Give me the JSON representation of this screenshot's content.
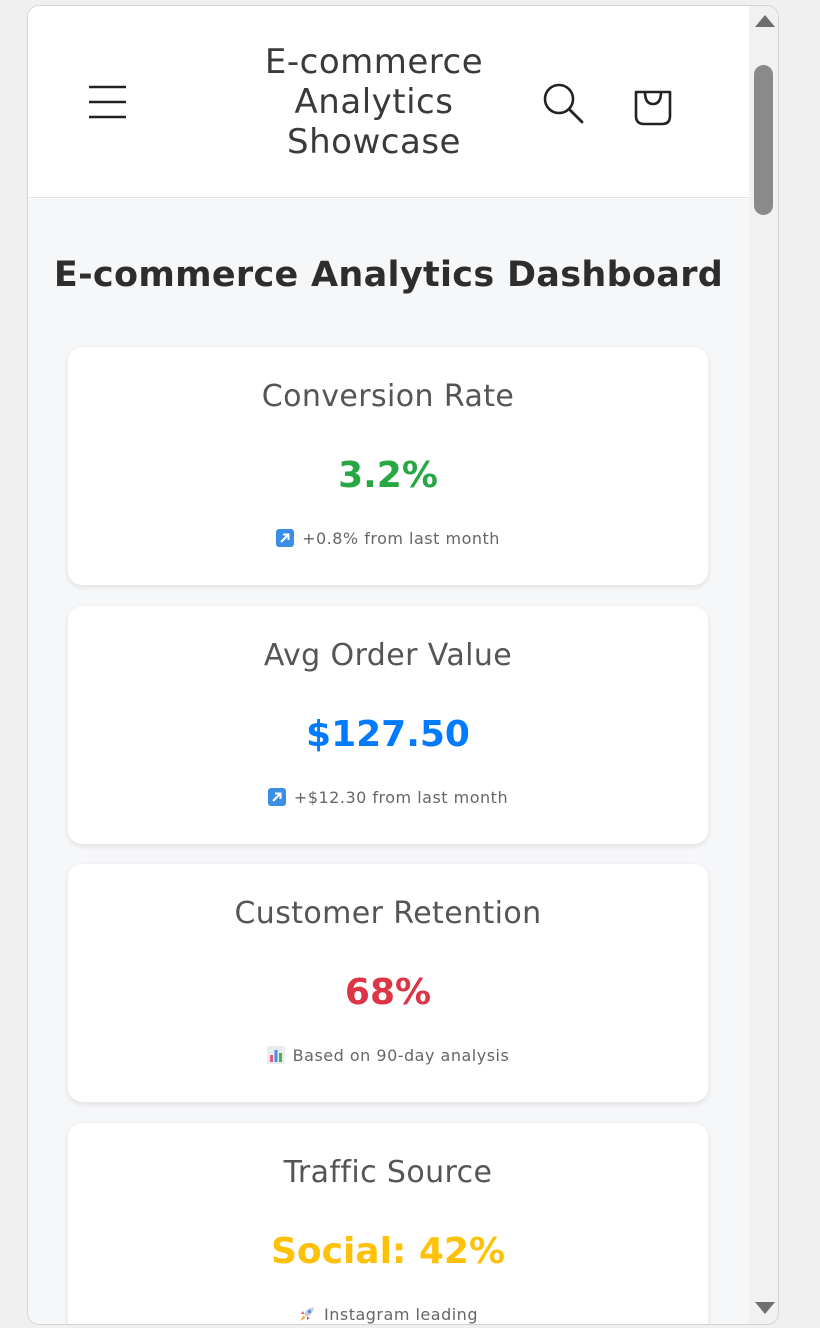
{
  "header": {
    "site_title_lines": [
      "E-commerce",
      "Analytics",
      "Showcase"
    ],
    "menu_icon": "hamburger-menu-icon",
    "search_icon": "search-icon",
    "cart_icon": "shopping-bag-icon"
  },
  "main": {
    "title": "E-commerce Analytics Dashboard",
    "cards": [
      {
        "title": "Conversion Rate",
        "value": "3.2%",
        "value_color": "#28a745",
        "note": "+0.8% from last month",
        "note_icon": "up-right-arrow-icon"
      },
      {
        "title": "Avg Order Value",
        "value": "$127.50",
        "value_color": "#007bff",
        "note": "+$12.30 from last month",
        "note_icon": "up-right-arrow-icon"
      },
      {
        "title": "Customer Retention",
        "value": "68%",
        "value_color": "#dc3545",
        "note": "Based on 90-day analysis",
        "note_icon": "bar-chart-icon"
      },
      {
        "title": "Traffic Source",
        "value": "Social: 42%",
        "value_color": "#ffc107",
        "note": "Instagram leading",
        "note_icon": "rocket-icon"
      }
    ]
  }
}
